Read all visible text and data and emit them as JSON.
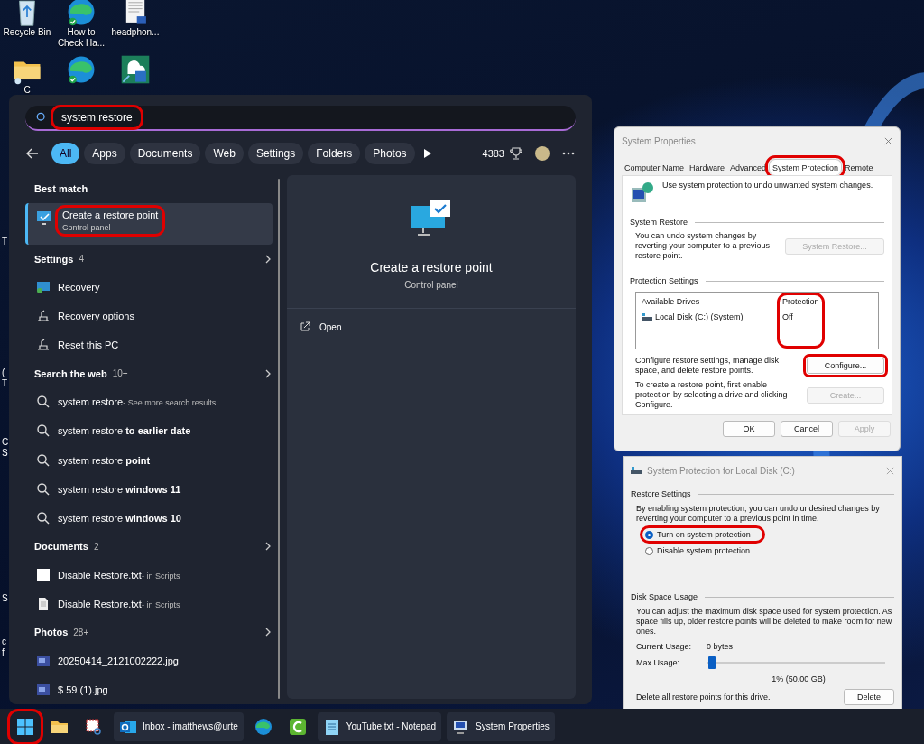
{
  "desktop": {
    "icons": [
      {
        "label": "Recycle Bin",
        "kind": "recycle"
      },
      {
        "label": "How to Check Ha...",
        "kind": "edge"
      },
      {
        "label": "headphon...",
        "kind": "document"
      },
      {
        "label": "C",
        "kind": "folder"
      },
      {
        "kind": "edge"
      },
      {
        "kind": "backup"
      }
    ],
    "edge_labels": [
      "T",
      "(",
      "T",
      "C",
      "S",
      "S",
      "c",
      "f"
    ]
  },
  "search": {
    "query": "system restore",
    "highlighted": true
  },
  "filters": [
    {
      "label": "All",
      "selected": true
    },
    {
      "label": "Apps",
      "selected": false
    },
    {
      "label": "Documents",
      "selected": false
    },
    {
      "label": "Web",
      "selected": false
    },
    {
      "label": "Settings",
      "selected": false
    },
    {
      "label": "Folders",
      "selected": false
    },
    {
      "label": "Photos",
      "selected": false
    }
  ],
  "points": "4383",
  "best_match": {
    "heading": "Best match",
    "title": "Create a restore point",
    "subtitle": "Control panel",
    "selected": true,
    "highlighted": true
  },
  "sections": [
    {
      "heading": "Settings",
      "count": "4",
      "items": [
        {
          "kind": "recovery",
          "text": "Recovery"
        },
        {
          "kind": "tool",
          "text": "Recovery options"
        },
        {
          "kind": "tool",
          "text": "Reset this PC"
        }
      ]
    },
    {
      "heading": "Search the web",
      "count": "10+",
      "items": [
        {
          "kind": "search",
          "text": "system restore",
          "suffix": "- See more search results"
        },
        {
          "kind": "search",
          "text": "system restore **to earlier date**"
        },
        {
          "kind": "search",
          "text": "system restore **point**"
        },
        {
          "kind": "search",
          "text": "system restore **windows 11**"
        },
        {
          "kind": "search",
          "text": "system restore **windows 10**"
        }
      ]
    },
    {
      "heading": "Documents",
      "count": "2",
      "items": [
        {
          "kind": "blank",
          "text": "Disable Restore.txt",
          "suffix": "- in Scripts"
        },
        {
          "kind": "text-file",
          "text": "Disable Restore.txt",
          "suffix": "- in Scripts"
        }
      ]
    },
    {
      "heading": "Photos",
      "count": "28+",
      "items": [
        {
          "kind": "photo",
          "text": "20250414_2121002222.jpg"
        },
        {
          "kind": "photo",
          "text": "$ 59 (1).jpg"
        }
      ]
    }
  ],
  "preview": {
    "title": "Create a restore point",
    "subtitle": "Control panel",
    "actions": [
      "Open"
    ]
  },
  "system_properties": {
    "title": "System Properties",
    "tabs": [
      {
        "label": "Computer Name",
        "selected": false
      },
      {
        "label": "Hardware",
        "selected": false
      },
      {
        "label": "Advanced",
        "selected": false
      },
      {
        "label": "System Protection",
        "selected": true,
        "highlighted": true
      },
      {
        "label": "Remote",
        "selected": false
      }
    ],
    "intro": "Use system protection to undo unwanted system changes.",
    "restore_heading": "System Restore",
    "restore_text": "You can undo system changes by reverting your computer to a previous restore point.",
    "restore_button": {
      "label": "System Restore...",
      "disabled": true
    },
    "protection_heading": "Protection Settings",
    "columns": [
      {
        "label": "Available Drives",
        "highlighted": false
      },
      {
        "label": "Protection",
        "highlighted": true
      }
    ],
    "drives": [
      {
        "name": "Local Disk (C:) (System)",
        "protection": "Off"
      }
    ],
    "configure_text": "Configure restore settings, manage disk space, and delete restore points.",
    "configure_button": {
      "label": "Configure...",
      "disabled": false,
      "highlighted": true
    },
    "create_text": "To create a restore point, first enable protection by selecting a drive and clicking Configure.",
    "create_button": {
      "label": "Create...",
      "disabled": true
    },
    "buttons": [
      {
        "label": "OK",
        "disabled": false
      },
      {
        "label": "Cancel",
        "disabled": false
      },
      {
        "label": "Apply",
        "disabled": true
      }
    ]
  },
  "protection_dialog": {
    "title": "System Protection for Local Disk (C:)",
    "restore_heading": "Restore Settings",
    "restore_text": "By enabling system protection, you can undo undesired changes by reverting your computer to a previous point in time.",
    "options": [
      {
        "label": "Turn on system protection",
        "selected": true,
        "highlighted": true
      },
      {
        "label": "Disable system protection",
        "selected": false,
        "highlighted": false
      }
    ],
    "disk_heading": "Disk Space Usage",
    "disk_text": "You can adjust the maximum disk space used for system protection. As space fills up, older restore points will be deleted to make room for new ones.",
    "current_label": "Current Usage:",
    "current_value": "0 bytes",
    "max_label": "Max Usage:",
    "max_usage": {
      "level": 0.01
    },
    "max_reading": "1% (50.00 GB)",
    "delete_text": "Delete all restore points for this drive.",
    "delete_button": "Delete"
  },
  "taskbar": [
    {
      "kind": "start",
      "highlighted": true,
      "running": false
    },
    {
      "kind": "folder",
      "running": false
    },
    {
      "kind": "snip",
      "running": false
    },
    {
      "kind": "mail",
      "label": "Inbox - imatthews@urte",
      "running": true
    },
    {
      "kind": "edge",
      "running": false
    },
    {
      "kind": "camtasia",
      "running": false
    },
    {
      "kind": "notepad",
      "label": "YouTube.txt - Notepad",
      "running": true
    },
    {
      "kind": "sysprop",
      "label": "System Properties",
      "running": true
    }
  ]
}
